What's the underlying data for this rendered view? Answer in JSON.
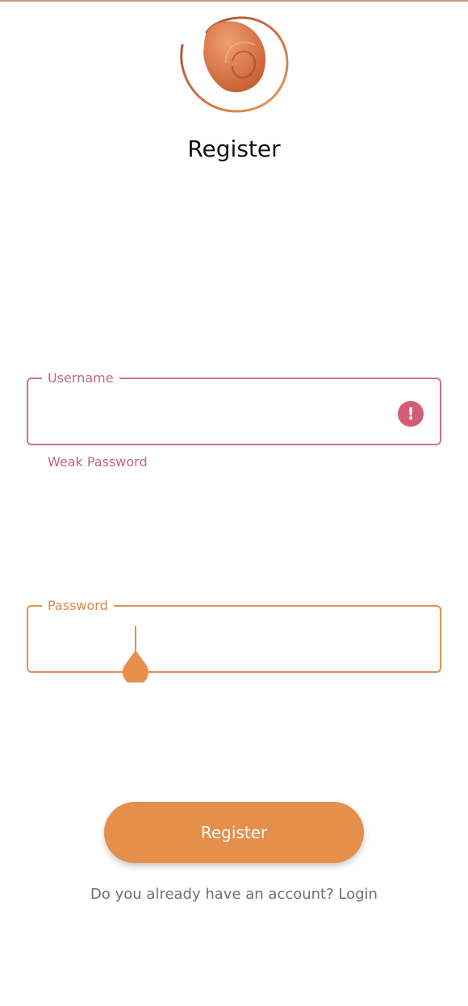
{
  "header": {
    "title": "Register",
    "logo": "shell-logo"
  },
  "form": {
    "username": {
      "label": "Username",
      "value": "",
      "helper_text": "Weak Password",
      "error_icon": "!"
    },
    "password": {
      "label": "Password",
      "value": ""
    },
    "register_button_label": "Register"
  },
  "footer": {
    "prompt": "Do you already have an account?",
    "login_link": "Login"
  },
  "colors": {
    "accent": "#e58f4b",
    "error": "#cf7289",
    "logo_gradient_dark": "#b3522e",
    "logo_gradient_light": "#e58f4b"
  }
}
